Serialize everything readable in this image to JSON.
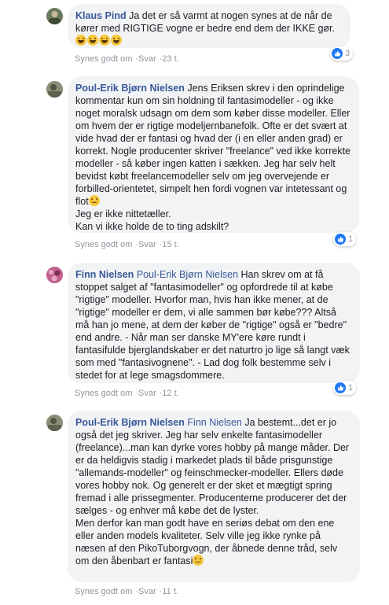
{
  "comments": [
    {
      "author": "Klaus Pind",
      "tag": "",
      "text": "Ja det er så varmt at nogen synes at de når de kører med RIGTIGE vogne er bedre end dem der IKKE gør.",
      "like_label": "Synes godt om",
      "reply_label": "Svar",
      "time": "23 t.",
      "reactions": "3"
    },
    {
      "author": "Poul-Erik Bjørn Nielsen",
      "tag": "",
      "text": "Jens Eriksen skrev i den oprindelige kommentar kun om sin holdning til fantasimodeller - og ikke noget moralsk udsagn om dem som køber disse modeller. Eller om hvem der er rigtige modeljernbanefolk. Ofte er det svært at vide hvad der er fantasi og hvad der (i en eller anden grad) er korrekt. Nogle producenter skriver \"freelance\" ved ikke korrekte modeller - så køber ingen katten i sækken. Jeg har selv helt bevidst købt freelancemodeller selv om jeg overvejende er forbilled-orientetet, simpelt hen fordi vognen var intetessant og flot",
      "text2": "Jeg er ikke nittetæller.",
      "text3": "Kan vi ikke holde de to ting adskilt?",
      "like_label": "Synes godt om",
      "reply_label": "Svar",
      "time": "15 t.",
      "reactions": "1"
    },
    {
      "author": "Finn Nielsen",
      "tag": "Poul-Erik Bjørn Nielsen",
      "text": "Han skrev om at få stoppet salget af \"fantasimodeller\" og opfordrede til at købe \"rigtige\" modeller. Hvorfor man, hvis han ikke mener, at de \"rigtige\" modeller er dem, vi alle sammen bør købe??? Altså må han jo mene, at dem der køber de \"rigtige\" også er \"bedre\" end andre. - Når man ser danske MY'ere køre rundt i fantasifulde bjerglandskaber er det naturtro jo lige så langt væk som med \"fantasivognene\". - Lad dog folk bestemme selv i stedet for at lege smagsdommere.",
      "like_label": "Synes godt om",
      "reply_label": "Svar",
      "time": "12 t.",
      "reactions": "1"
    },
    {
      "author": "Poul-Erik Bjørn Nielsen",
      "tag": "Finn Nielsen",
      "text": "Ja bestemt...det er jo også det jeg skriver. Jeg har selv enkelte fantasimodeller (freelance)...man kan dyrke vores hobby på mange måder. Der er da heldigvis stadig i markedet plads til både prisgunstige \"allemands-modeller\" og feinschmecker-modeller. Ellers døde vores hobby nok. Og generelt er der sket et mægtigt spring fremad i alle prissegmenter. Producenterne producerer det der sælges - og enhver må købe det de lyster.",
      "text2": "Men derfor kan man godt have en seriøs debat om den ene eller anden models kvaliteter. Selv ville jeg ikke rynke på næsen af den PikoTuborgvogn, der åbnede denne tråd, selv om den åbenbart er fantasi",
      "like_label": "Synes godt om",
      "reply_label": "Svar",
      "time": "11 t."
    }
  ]
}
